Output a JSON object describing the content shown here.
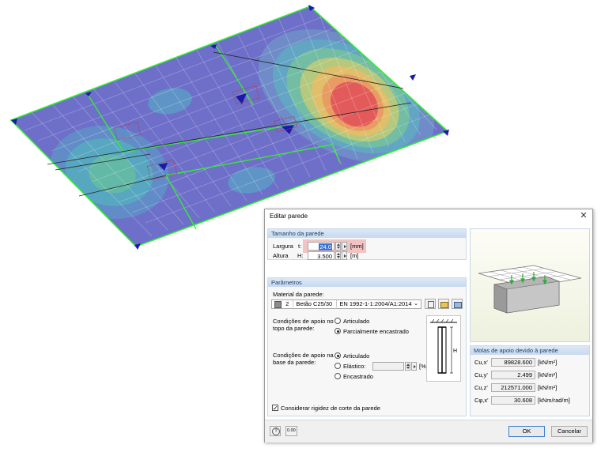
{
  "dialog": {
    "title": "Editar parede",
    "wall_size": {
      "header": "Tamanho da parede",
      "width_label": "Largura",
      "width_symbol": "t:",
      "width_value": "24.0",
      "width_unit": "[mm]",
      "height_label": "Altura",
      "height_symbol": "H:",
      "height_value": "3.500",
      "height_unit": "[m]"
    },
    "parameters": {
      "header": "Parâmetros",
      "material_label": "Material da parede:",
      "material_number": "2",
      "material_name": "Betão C25/30",
      "material_standard": "EN 1992-1-1:2004/A1:2014",
      "top_support_label_1": "Condições de apoio no",
      "top_support_label_2": "topo da parede:",
      "top_options": [
        "Articulado",
        "Parcialmente encastrado"
      ],
      "top_selected": 1,
      "base_support_label_1": "Condições de apoio na",
      "base_support_label_2": "base da parede:",
      "base_options": [
        "Articulado",
        "Elástico:",
        "Encastrado"
      ],
      "base_selected": 0,
      "elastic_unit": "[%]",
      "shear_checkbox_label": "Considerar rigidez de corte da parede",
      "shear_checked": true
    },
    "springs": {
      "header": "Molas de apoio devido à parede",
      "rows": [
        {
          "symbol": "Cu,x'",
          "value": "89828.600",
          "unit": "[kN/m²]"
        },
        {
          "symbol": "Cu,y'",
          "value": "2.499",
          "unit": "[kN/m²]"
        },
        {
          "symbol": "Cu,z'",
          "value": "212571.000",
          "unit": "[kN/m²]"
        },
        {
          "symbol": "Cφ,x'",
          "value": "30.608",
          "unit": "[kNm/rad/m]"
        }
      ]
    },
    "footer": {
      "ok_label": "OK",
      "cancel_label": "Cancelar",
      "units_button_label": "0.00"
    }
  },
  "colors": {
    "slab_base": "#6e6fc9",
    "contour_high": "#e35a5a",
    "mesh_green": "#33ee33",
    "panel_header": "#c8d9ee"
  }
}
